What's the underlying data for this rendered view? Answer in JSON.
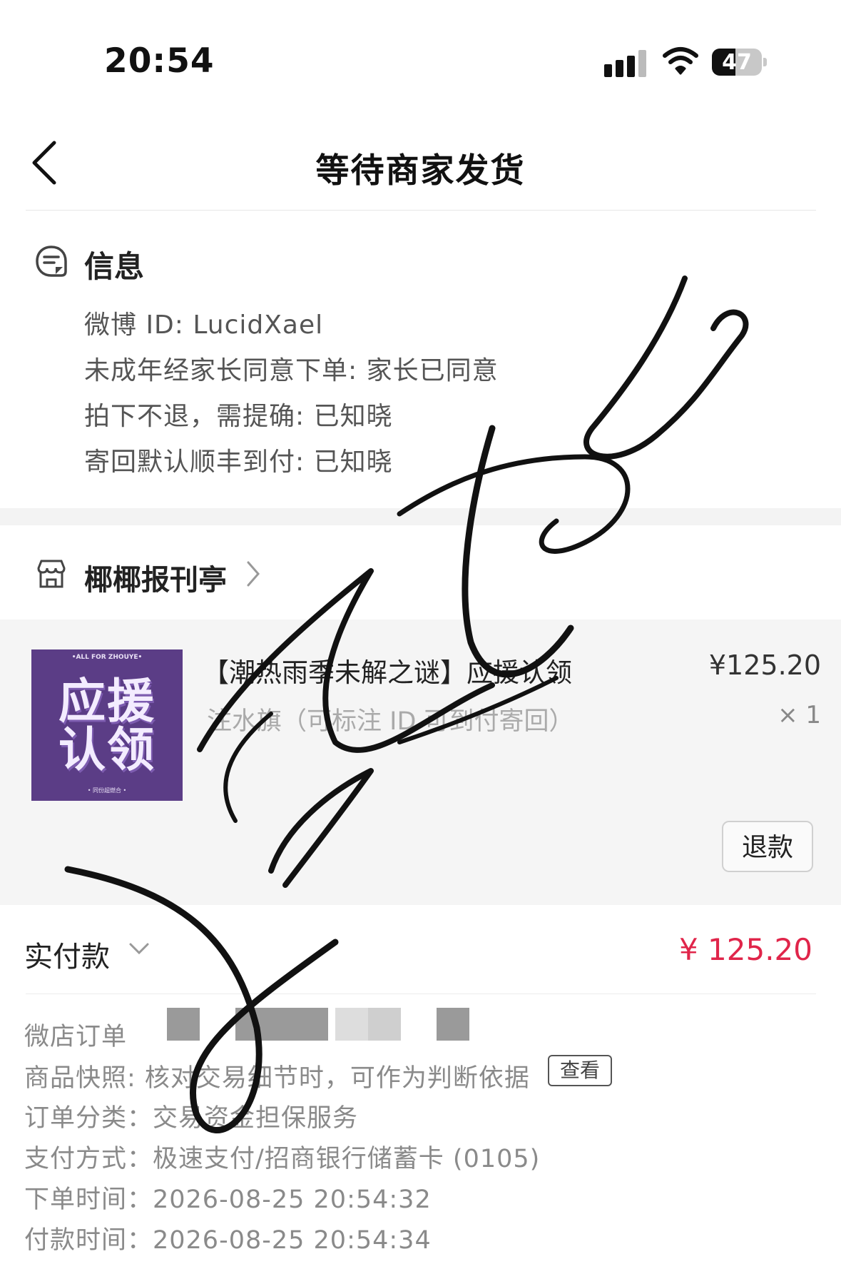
{
  "status": {
    "time": "20:54",
    "battery": "47"
  },
  "nav": {
    "title": "等待商家发货"
  },
  "info": {
    "title": "信息",
    "lines": [
      "微博 ID: LucidXael",
      "未成年经家长同意下单: 家长已同意",
      "拍下不退，需提确: 已知晓",
      "寄回默认顺丰到付: 已知晓"
    ]
  },
  "shop": {
    "name": "椰椰报刊亭"
  },
  "product": {
    "thumb_top": "•ALL FOR ZHOUYE•",
    "thumb_line1": "应援",
    "thumb_line2": "认领",
    "thumb_bottom": "• 同份超燃合 •",
    "name": "【潮热雨季未解之谜】应援认领",
    "desc": "注水旗（可标注 ID 可到付寄回）",
    "price": "¥125.20",
    "qty": "× 1",
    "refund_label": "退款"
  },
  "total": {
    "label": "实付款",
    "amount": "¥ 125.20"
  },
  "details": {
    "order_label": "微店订单",
    "snapshot": "商品快照: 核对交易细节时，可作为判断依据",
    "snapshot_btn": "查看",
    "category": "订单分类：交易资金担保服务",
    "payment": "支付方式：极速支付/招商银行储蓄卡 (0105)",
    "order_time": "下单时间：2026-08-25 20:54:32",
    "pay_time": "付款时间：2026-08-25 20:54:34"
  },
  "colors": {
    "accent_price": "#e0254a",
    "thumb_bg": "#5b3d86"
  }
}
